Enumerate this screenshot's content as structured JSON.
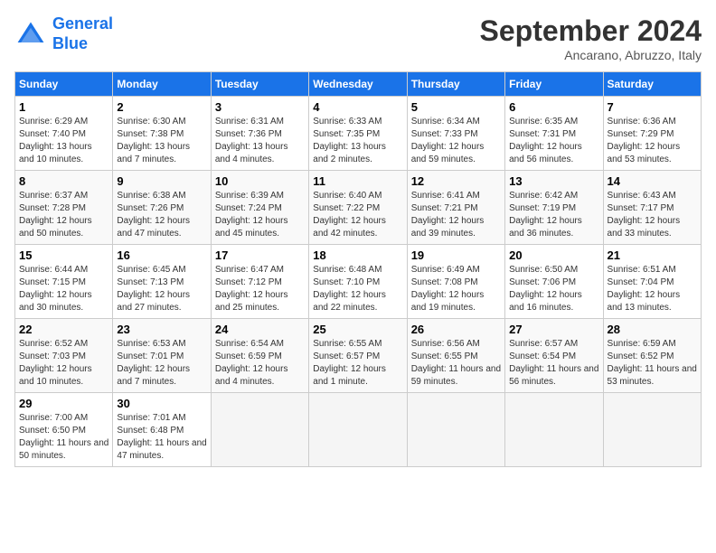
{
  "logo": {
    "line1": "General",
    "line2": "Blue"
  },
  "title": "September 2024",
  "subtitle": "Ancarano, Abruzzo, Italy",
  "weekdays": [
    "Sunday",
    "Monday",
    "Tuesday",
    "Wednesday",
    "Thursday",
    "Friday",
    "Saturday"
  ],
  "weeks": [
    [
      {
        "day": "1",
        "sunrise": "6:29 AM",
        "sunset": "7:40 PM",
        "daylight": "13 hours and 10 minutes."
      },
      {
        "day": "2",
        "sunrise": "6:30 AM",
        "sunset": "7:38 PM",
        "daylight": "13 hours and 7 minutes."
      },
      {
        "day": "3",
        "sunrise": "6:31 AM",
        "sunset": "7:36 PM",
        "daylight": "13 hours and 4 minutes."
      },
      {
        "day": "4",
        "sunrise": "6:33 AM",
        "sunset": "7:35 PM",
        "daylight": "13 hours and 2 minutes."
      },
      {
        "day": "5",
        "sunrise": "6:34 AM",
        "sunset": "7:33 PM",
        "daylight": "12 hours and 59 minutes."
      },
      {
        "day": "6",
        "sunrise": "6:35 AM",
        "sunset": "7:31 PM",
        "daylight": "12 hours and 56 minutes."
      },
      {
        "day": "7",
        "sunrise": "6:36 AM",
        "sunset": "7:29 PM",
        "daylight": "12 hours and 53 minutes."
      }
    ],
    [
      {
        "day": "8",
        "sunrise": "6:37 AM",
        "sunset": "7:28 PM",
        "daylight": "12 hours and 50 minutes."
      },
      {
        "day": "9",
        "sunrise": "6:38 AM",
        "sunset": "7:26 PM",
        "daylight": "12 hours and 47 minutes."
      },
      {
        "day": "10",
        "sunrise": "6:39 AM",
        "sunset": "7:24 PM",
        "daylight": "12 hours and 45 minutes."
      },
      {
        "day": "11",
        "sunrise": "6:40 AM",
        "sunset": "7:22 PM",
        "daylight": "12 hours and 42 minutes."
      },
      {
        "day": "12",
        "sunrise": "6:41 AM",
        "sunset": "7:21 PM",
        "daylight": "12 hours and 39 minutes."
      },
      {
        "day": "13",
        "sunrise": "6:42 AM",
        "sunset": "7:19 PM",
        "daylight": "12 hours and 36 minutes."
      },
      {
        "day": "14",
        "sunrise": "6:43 AM",
        "sunset": "7:17 PM",
        "daylight": "12 hours and 33 minutes."
      }
    ],
    [
      {
        "day": "15",
        "sunrise": "6:44 AM",
        "sunset": "7:15 PM",
        "daylight": "12 hours and 30 minutes."
      },
      {
        "day": "16",
        "sunrise": "6:45 AM",
        "sunset": "7:13 PM",
        "daylight": "12 hours and 27 minutes."
      },
      {
        "day": "17",
        "sunrise": "6:47 AM",
        "sunset": "7:12 PM",
        "daylight": "12 hours and 25 minutes."
      },
      {
        "day": "18",
        "sunrise": "6:48 AM",
        "sunset": "7:10 PM",
        "daylight": "12 hours and 22 minutes."
      },
      {
        "day": "19",
        "sunrise": "6:49 AM",
        "sunset": "7:08 PM",
        "daylight": "12 hours and 19 minutes."
      },
      {
        "day": "20",
        "sunrise": "6:50 AM",
        "sunset": "7:06 PM",
        "daylight": "12 hours and 16 minutes."
      },
      {
        "day": "21",
        "sunrise": "6:51 AM",
        "sunset": "7:04 PM",
        "daylight": "12 hours and 13 minutes."
      }
    ],
    [
      {
        "day": "22",
        "sunrise": "6:52 AM",
        "sunset": "7:03 PM",
        "daylight": "12 hours and 10 minutes."
      },
      {
        "day": "23",
        "sunrise": "6:53 AM",
        "sunset": "7:01 PM",
        "daylight": "12 hours and 7 minutes."
      },
      {
        "day": "24",
        "sunrise": "6:54 AM",
        "sunset": "6:59 PM",
        "daylight": "12 hours and 4 minutes."
      },
      {
        "day": "25",
        "sunrise": "6:55 AM",
        "sunset": "6:57 PM",
        "daylight": "12 hours and 1 minute."
      },
      {
        "day": "26",
        "sunrise": "6:56 AM",
        "sunset": "6:55 PM",
        "daylight": "11 hours and 59 minutes."
      },
      {
        "day": "27",
        "sunrise": "6:57 AM",
        "sunset": "6:54 PM",
        "daylight": "11 hours and 56 minutes."
      },
      {
        "day": "28",
        "sunrise": "6:59 AM",
        "sunset": "6:52 PM",
        "daylight": "11 hours and 53 minutes."
      }
    ],
    [
      {
        "day": "29",
        "sunrise": "7:00 AM",
        "sunset": "6:50 PM",
        "daylight": "11 hours and 50 minutes."
      },
      {
        "day": "30",
        "sunrise": "7:01 AM",
        "sunset": "6:48 PM",
        "daylight": "11 hours and 47 minutes."
      },
      null,
      null,
      null,
      null,
      null
    ]
  ]
}
